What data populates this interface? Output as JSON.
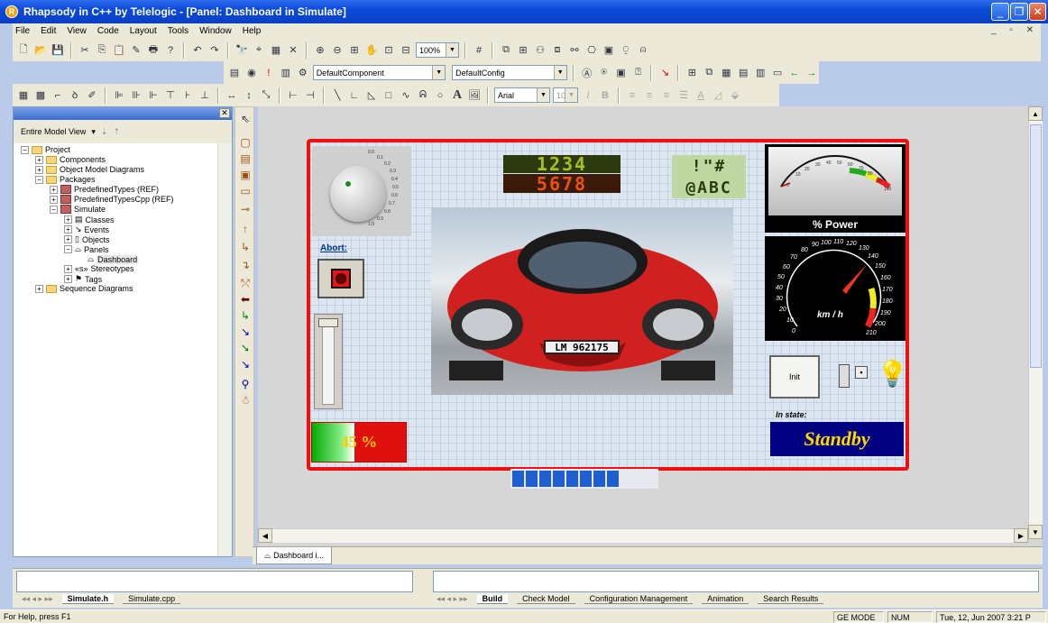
{
  "window": {
    "title": "Rhapsody in C++ by Telelogic - [Panel: Dashboard in Simulate]"
  },
  "menu": [
    "File",
    "Edit",
    "View",
    "Code",
    "Layout",
    "Tools",
    "Window",
    "Help"
  ],
  "toolbar": {
    "zoom": "100%",
    "component": "DefaultComponent",
    "config": "DefaultConfig",
    "font": "Arial",
    "font_size": "10"
  },
  "browser": {
    "view": "Entire Model View",
    "tree": [
      "Project",
      "Components",
      "Object Model Diagrams",
      "Packages",
      "PredefinedTypes (REF)",
      "PredefinedTypesCpp (REF)",
      "Simulate",
      "Classes",
      "Events",
      "Objects",
      "Panels",
      "Dashboard",
      "Stereotypes",
      "Tags",
      "Sequence Diagrams"
    ]
  },
  "panel": {
    "abort_label": "Abort:",
    "seg_top": "1234",
    "seg_bottom": "5678",
    "dot_top": "!\"#",
    "dot_bottom": "@ABC",
    "power_label": "% Power",
    "speed_unit": "km / h",
    "speed_ticks": [
      "0",
      "10",
      "20",
      "30",
      "40",
      "50",
      "60",
      "70",
      "80",
      "90",
      "100",
      "110",
      "120",
      "130",
      "140",
      "150",
      "160",
      "170",
      "180",
      "190",
      "200",
      "210"
    ],
    "power_ticks": [
      "0",
      "10",
      "20",
      "30",
      "40",
      "50",
      "60",
      "70",
      "80",
      "90",
      "100"
    ],
    "knob_ticks": [
      "0.0",
      "0.1",
      "0.2",
      "0.3",
      "0.4",
      "0.5",
      "0.6",
      "0.7",
      "0.8",
      "0.9",
      "1.0"
    ],
    "license_plate": "LM 962175",
    "progress_text": "45 %",
    "progress_value": 0.45,
    "init_label": "Init",
    "in_state_label": "In state:",
    "state_value": "Standby",
    "blocks_filled": 8
  },
  "doc_tab": "Dashboard i...",
  "output": {
    "left_tabs": [
      "Simulate.h",
      "Simulate.cpp"
    ],
    "right_tabs": [
      "Build",
      "Check Model",
      "Configuration Management",
      "Animation",
      "Search Results"
    ]
  },
  "status": {
    "help": "For Help, press F1",
    "mode": "GE MODE",
    "num": "NUM",
    "datetime": "Tue, 12, Jun 2007  3:21 P"
  },
  "colors": {
    "frame": "#ee1111",
    "state_bg": "#000080",
    "state_fg": "#ffd700",
    "progress_fill": "#00aa00",
    "block": "#1e5fd0"
  }
}
